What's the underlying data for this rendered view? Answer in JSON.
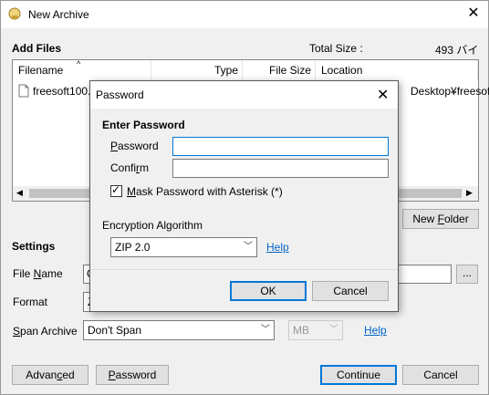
{
  "window": {
    "title": "New Archive",
    "close_glyph": "✕"
  },
  "add_files": {
    "heading": "Add Files",
    "total_size_label": "Total Size :",
    "total_size_value": "493 バイト",
    "columns": [
      "Filename",
      "Type",
      "File Size",
      "Location"
    ],
    "rows": [
      {
        "filename": "freesoft100.t",
        "location": "Desktop¥freesoft"
      }
    ],
    "new_folder_prefix": "New ",
    "new_folder_key": "F",
    "new_folder_suffix": "older"
  },
  "settings": {
    "heading": "Settings",
    "file_name_label_pre": "File ",
    "file_name_label_key": "N",
    "file_name_label_post": "ame",
    "file_name_value": "C",
    "format_label": "Format",
    "format_value": "Z",
    "span_label_key": "S",
    "span_label_post": "pan Archive",
    "span_value": "Don't Span",
    "unit_value": "MB",
    "help": "Help",
    "browse": "..."
  },
  "buttons": {
    "advanced_pre": "Advan",
    "advanced_key": "c",
    "advanced_post": "ed",
    "password_key": "P",
    "password_post": "assword",
    "continue": "Continue",
    "cancel": "Cancel"
  },
  "dialog": {
    "title": "Password",
    "close_glyph": "✕",
    "enter_heading": "Enter Password",
    "password_label_key": "P",
    "password_label_post": "assword",
    "confirm_label_pre": "Confi",
    "confirm_label_key": "r",
    "confirm_label_post": "m",
    "mask_checked": true,
    "mask_label_key": "M",
    "mask_label_post": "ask Password with Asterisk (*)",
    "enc_heading": "Encryption Algorithm",
    "enc_value": "ZIP 2.0",
    "help": "Help",
    "ok": "OK",
    "cancel": "Cancel"
  },
  "colors": {
    "accent": "#0078d7",
    "link": "#0066cc"
  }
}
